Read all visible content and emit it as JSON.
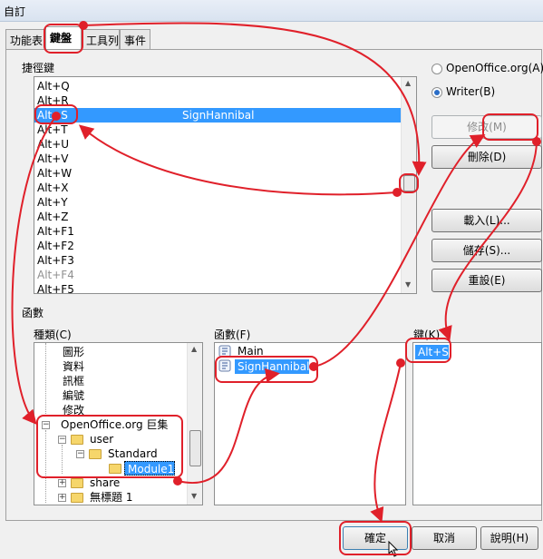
{
  "window": {
    "title": "自訂"
  },
  "tabs": [
    "功能表",
    "鍵盤",
    "工具列",
    "事件"
  ],
  "shortcuts": {
    "group_label": "捷徑鍵",
    "rows": [
      {
        "key": "Alt+Q",
        "command": ""
      },
      {
        "key": "Alt+R",
        "command": ""
      },
      {
        "key": "Alt+S",
        "command": "SignHannibal"
      },
      {
        "key": "Alt+T",
        "command": ""
      },
      {
        "key": "Alt+U",
        "command": ""
      },
      {
        "key": "Alt+V",
        "command": ""
      },
      {
        "key": "Alt+W",
        "command": ""
      },
      {
        "key": "Alt+X",
        "command": ""
      },
      {
        "key": "Alt+Y",
        "command": ""
      },
      {
        "key": "Alt+Z",
        "command": ""
      },
      {
        "key": "Alt+F1",
        "command": ""
      },
      {
        "key": "Alt+F2",
        "command": ""
      },
      {
        "key": "Alt+F3",
        "command": ""
      },
      {
        "key": "Alt+F4",
        "command": ""
      },
      {
        "key": "Alt+F5",
        "command": ""
      }
    ]
  },
  "scope": {
    "openoffice": "OpenOffice.org(A)",
    "writer": "Writer(B)",
    "selected": "writer"
  },
  "side_buttons": {
    "modify": "修改(M)",
    "delete": "刪除(D)",
    "load": "載入(L)...",
    "save": "儲存(S)...",
    "reset": "重設(E)"
  },
  "functions": {
    "group_label": "函數",
    "category_label": "種類(C)",
    "function_label": "函數(F)",
    "keys_label": "鍵(K)",
    "categories": [
      "圖形",
      "資料",
      "訊框",
      "編號",
      "修改"
    ],
    "tree": {
      "root": "OpenOffice.org 巨集",
      "user": "user",
      "standard": "Standard",
      "module": "Module1",
      "share": "share",
      "untitled": "無標題 1"
    },
    "function_items": [
      "Main",
      "SignHannibal"
    ],
    "key_items": [
      "Alt+S"
    ]
  },
  "footer": {
    "ok": "確定",
    "cancel": "取消",
    "help": "說明(H)"
  },
  "colors": {
    "selection": "#3399ff",
    "annotation": "#e0202a"
  }
}
